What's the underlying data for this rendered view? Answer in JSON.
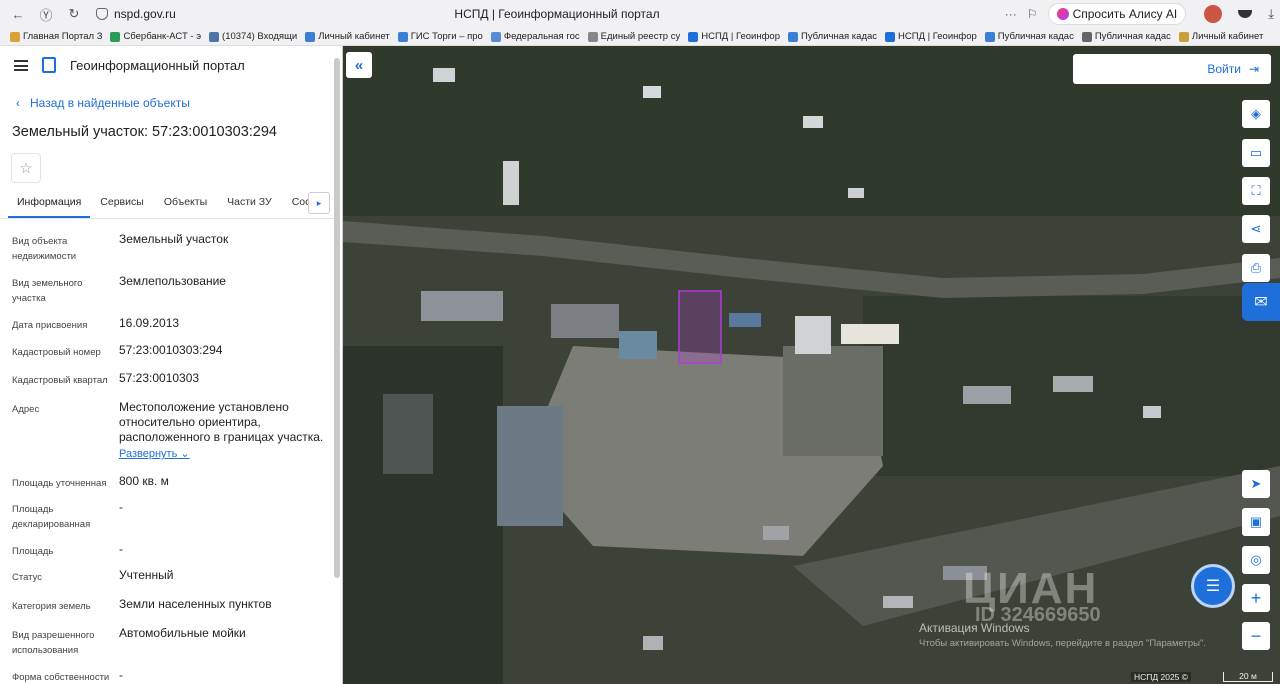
{
  "browser": {
    "url": "nspd.gov.ru",
    "page_title": "НСПД | Геоинформационный портал",
    "alice_label": "Спросить Алису AI",
    "bookmarks": [
      "Главная Портал З",
      "Сбербанк-АСТ - э",
      "(10374) Входящи",
      "Личный кабинет",
      "ГИС Торги – про",
      "Федеральная гос",
      "Единый реестр су",
      "НСПД | Геоинфор",
      "Публичная кадас",
      "НСПД | Геоинфор",
      "Публичная кадас",
      "Публичная кадас",
      "Личный кабинет"
    ]
  },
  "sidebar": {
    "portal_title": "Геоинформационный портал",
    "back_label": "Назад в найденные объекты",
    "parcel_title": "Земельный участок: 57:23:0010303:294",
    "tabs": [
      "Информация",
      "Сервисы",
      "Объекты",
      "Части ЗУ",
      "Соста"
    ],
    "properties": [
      {
        "label": "Вид объекта недвижимости",
        "value": "Земельный участок"
      },
      {
        "label": "Вид земельного участка",
        "value": "Землепользование"
      },
      {
        "label": "Дата присвоения",
        "value": "16.09.2013"
      },
      {
        "label": "Кадастровый номер",
        "value": "57:23:0010303:294"
      },
      {
        "label": "Кадастровый квартал",
        "value": "57:23:0010303"
      },
      {
        "label": "Адрес",
        "value": "Местоположение установлено относительно ориентира, расположенного в границах участка."
      },
      {
        "label": "Площадь уточненная",
        "value": "800 кв. м"
      },
      {
        "label": "Площадь декларированная",
        "value": "-"
      },
      {
        "label": "Площадь",
        "value": "-"
      },
      {
        "label": "Статус",
        "value": "Учтенный"
      },
      {
        "label": "Категория земель",
        "value": "Земли населенных пунктов"
      },
      {
        "label": "Вид разрешенного использования",
        "value": "Автомобильные мойки"
      },
      {
        "label": "Форма собственности",
        "value": "-"
      }
    ],
    "expand_label": "Развернуть"
  },
  "map": {
    "login_label": "Войти",
    "watermark_title": "Активация Windows",
    "watermark_text": "Чтобы активировать Windows, перейдите в раздел \"Параметры\".",
    "cian_text": "ЦИАН",
    "cian_id": "ID 324669650",
    "copyright": "НСПД 2025 ©",
    "scale": "20 м",
    "parcel_color": "#b23ad6",
    "accent": "#1e6fd9"
  }
}
